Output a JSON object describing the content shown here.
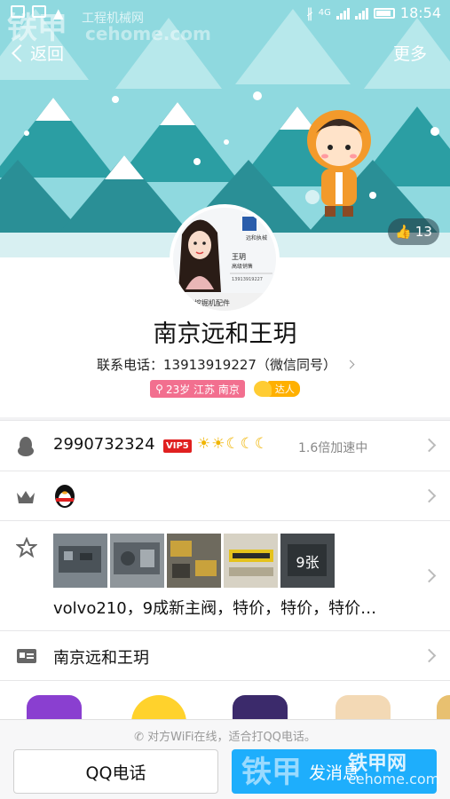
{
  "statusbar": {
    "network": "4G",
    "time": "18:54"
  },
  "nav": {
    "back_label": "返回",
    "more_label": "更多"
  },
  "likes": {
    "count": "13"
  },
  "profile": {
    "name": "南京远和王玥",
    "phone": "联系电话：13913919227（微信同号）",
    "tag_location": "23岁 江苏 南京",
    "tag_daren": "达人",
    "avatar_card": {
      "name": "王玥",
      "title": "高级销售",
      "phone": "13913919227",
      "company": "远和挖掘机配件"
    }
  },
  "qq": {
    "number": "2990732324",
    "vip": "VIP5",
    "level_icons": "☀☀☾☾☾",
    "speed": "1.6倍加速中"
  },
  "photos": {
    "more_count": "9张",
    "caption": "volvo210，9成新主阀，特价，特价，特价…"
  },
  "card": {
    "label": "南京远和王玥"
  },
  "bottom": {
    "hint": "对方WiFi在线，适合打QQ电话。",
    "call_label": "QQ电话",
    "message_label": "发消息"
  },
  "watermark": {
    "brand": "铁甲",
    "site_cn": "工程机械网",
    "site_url": "cehome.com",
    "brand_net": "铁甲网"
  },
  "colors": {
    "accent": "#1eaefc",
    "banner_bg": "#8ed8df",
    "vip_red": "#e02020",
    "tag_pink": "#f26f8f"
  }
}
